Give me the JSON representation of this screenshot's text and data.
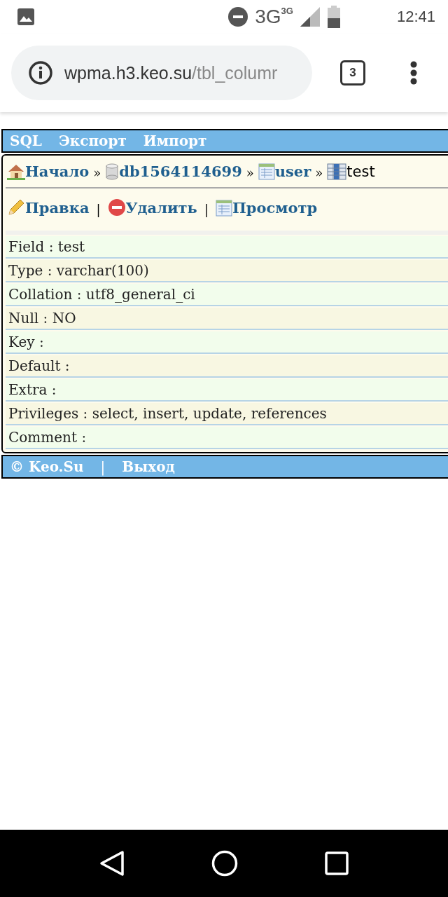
{
  "status_bar": {
    "network": "3G",
    "network_small": "3G",
    "time": "12:41"
  },
  "browser": {
    "url_host": "wpma.h3.keo.su",
    "url_path": "/tbl_columr",
    "tab_count": "3"
  },
  "menu": [
    "SQL",
    "Экспорт",
    "Импорт"
  ],
  "breadcrumb": [
    {
      "kind": "link",
      "label": "Начало"
    },
    {
      "kind": "sep",
      "label": "»"
    },
    {
      "kind": "link",
      "label": "db1564114699"
    },
    {
      "kind": "sep",
      "label": "»"
    },
    {
      "kind": "link",
      "label": "user"
    },
    {
      "kind": "sep",
      "label": "»"
    },
    {
      "kind": "current",
      "label": "test"
    }
  ],
  "actions": [
    {
      "kind": "link",
      "label": "Правка"
    },
    {
      "kind": "sep",
      "label": "|"
    },
    {
      "kind": "link",
      "label": "Удалить"
    },
    {
      "kind": "sep",
      "label": "|"
    },
    {
      "kind": "link",
      "label": "Просмотр"
    }
  ],
  "properties": [
    "Field : test",
    "Type : varchar(100)",
    "Collation : utf8_general_ci",
    "Null : NO",
    "Key :",
    "Default :",
    "Extra :",
    "Privileges : select, insert, update, references",
    "Comment :"
  ],
  "footer": [
    {
      "kind": "text",
      "label": "© Keo.Su"
    },
    {
      "kind": "sep",
      "label": "|"
    },
    {
      "kind": "link",
      "label": "Выход"
    }
  ]
}
